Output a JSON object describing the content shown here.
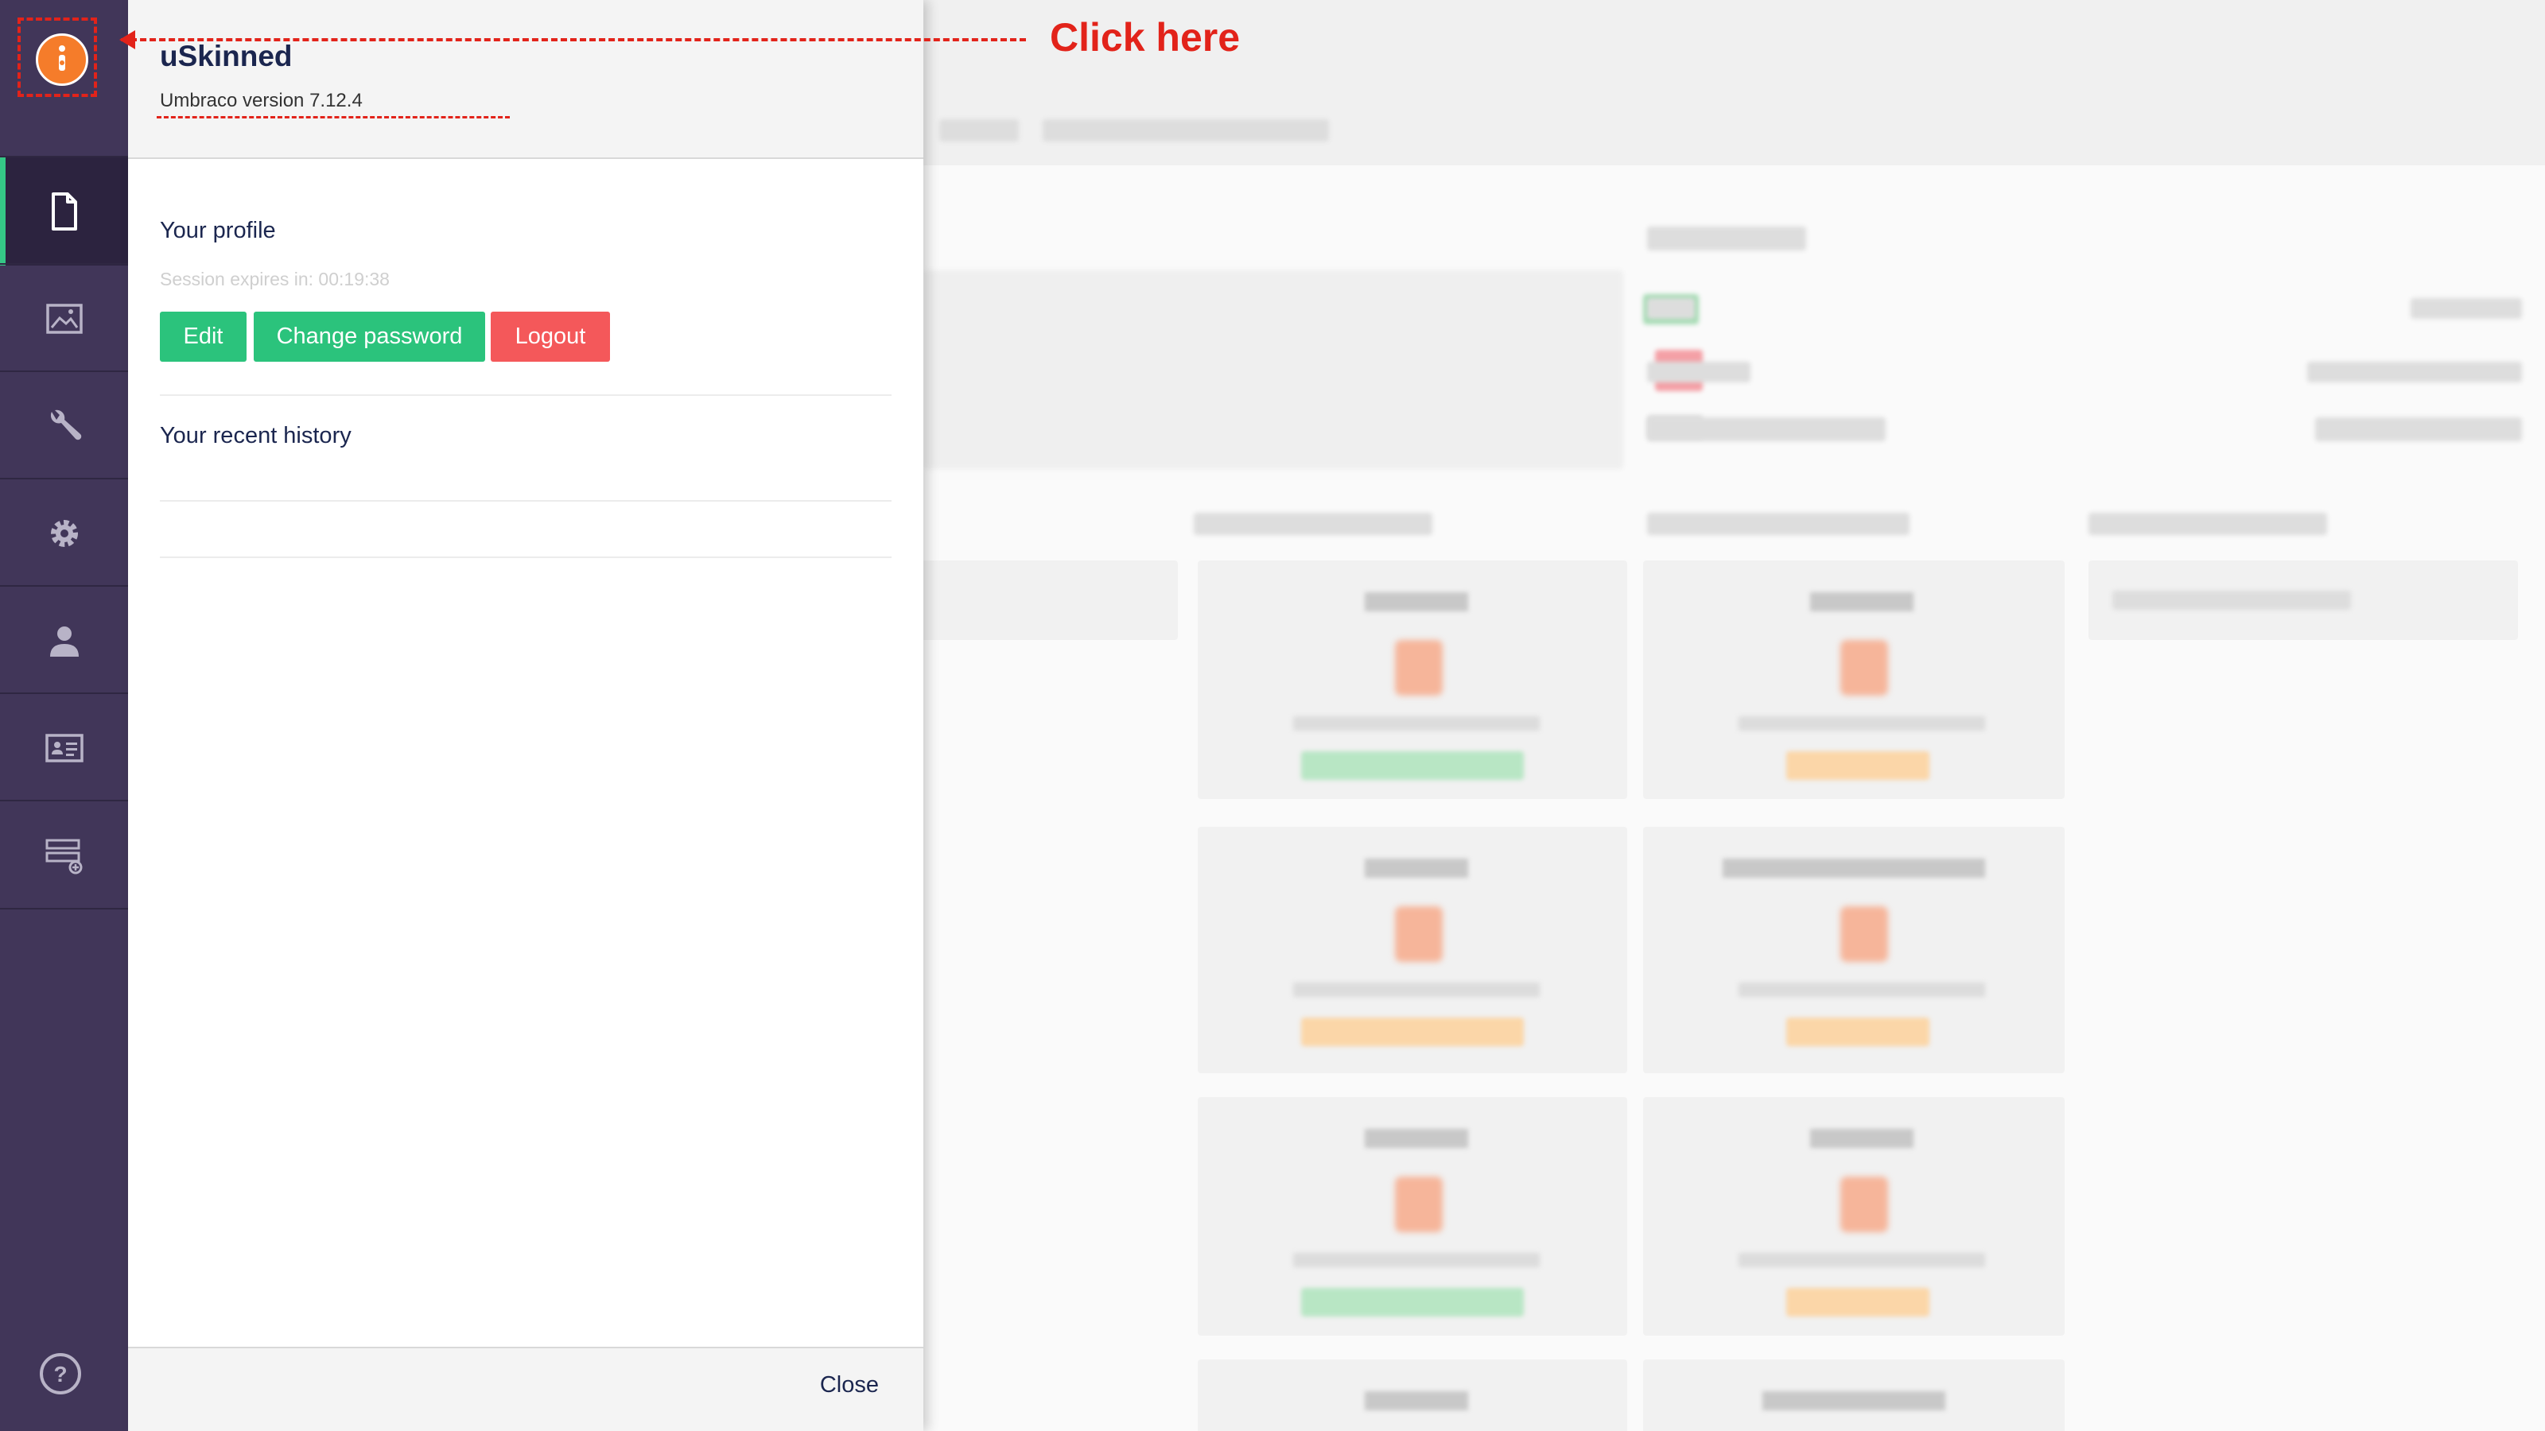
{
  "panel": {
    "title": "uSkinned",
    "version": "Umbraco version 7.12.4",
    "profile": {
      "heading": "Your profile",
      "session": "Session expires in: 00:19:38",
      "edit_label": "Edit",
      "change_password_label": "Change password",
      "logout_label": "Logout"
    },
    "history": {
      "heading": "Your recent history"
    },
    "close_label": "Close"
  },
  "nav": {
    "items": [
      {
        "icon": "document-icon",
        "active": true
      },
      {
        "icon": "image-icon",
        "active": false
      },
      {
        "icon": "wrench-icon",
        "active": false
      },
      {
        "icon": "gear-icon",
        "active": false
      },
      {
        "icon": "user-icon",
        "active": false
      },
      {
        "icon": "id-card-icon",
        "active": false
      },
      {
        "icon": "form-icon",
        "active": false
      }
    ],
    "help_icon": "help-icon",
    "avatar_icon": "user-avatar-icon"
  },
  "annotation": {
    "text": "Click here"
  },
  "colors": {
    "rail": "#413659",
    "rail_active": "#2c233f",
    "accent_green": "#2bc37c",
    "logout_red": "#f4585a",
    "avatar_orange": "#f57c2a",
    "annotation_red": "#e2231a"
  }
}
